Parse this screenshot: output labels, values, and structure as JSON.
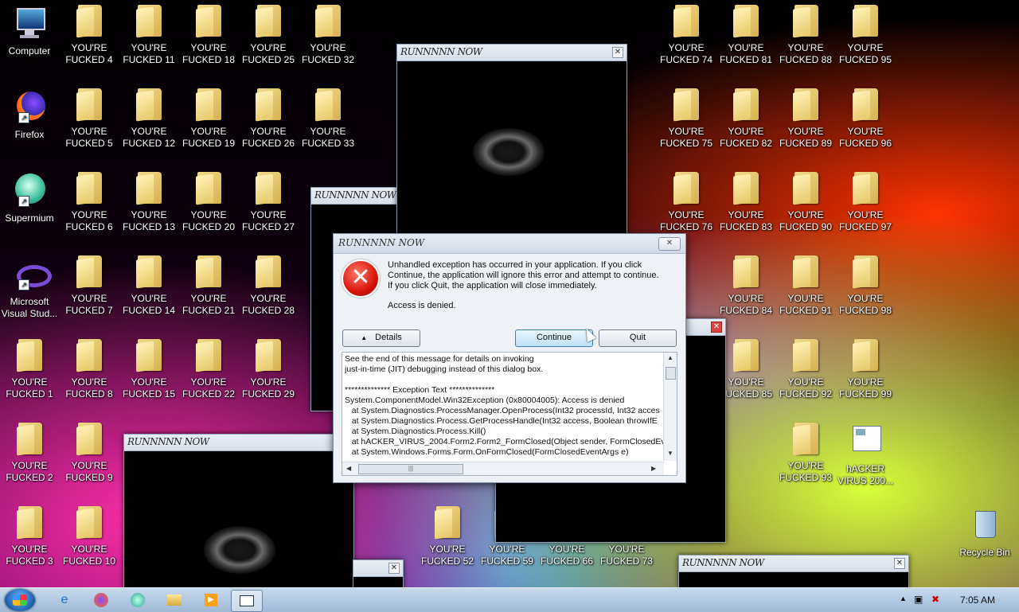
{
  "desktop": {
    "system_icons": [
      {
        "label": "Computer",
        "icon": "computer-icon"
      },
      {
        "label": "Firefox",
        "icon": "firefox-icon"
      },
      {
        "label": "Supermium",
        "icon": "supermium-icon"
      },
      {
        "label": "Microsoft Visual Stud...",
        "icon": "visual-studio-icon"
      }
    ],
    "folders_col0": [
      "YOU'RE FUCKED 1",
      "YOU'RE FUCKED 2",
      "YOU'RE FUCKED 3"
    ],
    "folders_col1": [
      "YOU'RE FUCKED 4",
      "YOU'RE FUCKED 5",
      "YOU'RE FUCKED 6",
      "YOU'RE FUCKED 7",
      "YOU'RE FUCKED 8",
      "YOU'RE FUCKED 9",
      "YOU'RE FUCKED 10"
    ],
    "folders_col2": [
      "YOU'RE FUCKED 11",
      "YOU'RE FUCKED 12",
      "YOU'RE FUCKED 13",
      "YOU'RE FUCKED 14",
      "YOU'RE FUCKED 15"
    ],
    "folders_col3": [
      "YOU'RE FUCKED 18",
      "YOU'RE FUCKED 19",
      "YOU'RE FUCKED 20",
      "YOU'RE FUCKED 21",
      "YOU'RE FUCKED 22"
    ],
    "folders_col4": [
      "YOU'RE FUCKED 25",
      "YOU'RE FUCKED 26",
      "YOU'RE FUCKED 27",
      "YOU'RE FUCKED 28",
      "YOU'RE FUCKED 29"
    ],
    "folders_col5": [
      "YOU'RE FUCKED 32",
      "YOU'RE FUCKED 33"
    ],
    "folders_col11": [
      "YOU'RE FUCKED 74",
      "YOU'RE FUCKED 75",
      "YOU'RE FUCKED 76"
    ],
    "folders_col12": [
      "YOU'RE FUCKED 81",
      "YOU'RE FUCKED 82",
      "YOU'RE FUCKED 83",
      "YOU'RE FUCKED 84",
      "YOU'RE FUCKED 85"
    ],
    "folders_col13": [
      "YOU'RE FUCKED 88",
      "YOU'RE FUCKED 89",
      "YOU'RE FUCKED 90",
      "YOU'RE FUCKED 91",
      "YOU'RE FUCKED 92",
      "YOU'RE FUCKED 93"
    ],
    "folders_col14": [
      "YOU'RE FUCKED 95",
      "YOU'RE FUCKED 96",
      "YOU'RE FUCKED 97",
      "YOU'RE FUCKED 98",
      "YOU'RE FUCKED 99"
    ],
    "bottom_row": [
      "YOU'RE FUCKED 52",
      "YOU'RE FUCKED 59",
      "YOU'RE FUCKED 66",
      "YOU'RE FUCKED 73"
    ],
    "hacker_label": "hACKER VIRUS 200...",
    "recycle_label": "Recycle Bin"
  },
  "windows": {
    "title": "RUNNNNN NOW"
  },
  "dialog": {
    "title": "RUNNNNN NOW",
    "message": "Unhandled exception has occurred in your application. If you click Continue, the application will ignore this error and attempt to continue. If you click Quit, the application will close immediately.",
    "sub_message": "Access is denied.",
    "details_label": "Details",
    "continue_label": "Continue",
    "quit_label": "Quit",
    "details_text": "See the end of this message for details on invoking\njust-in-time (JIT) debugging instead of this dialog box.\n\n************** Exception Text **************\nSystem.ComponentModel.Win32Exception (0x80004005): Access is denied\n   at System.Diagnostics.ProcessManager.OpenProcess(Int32 processId, Int32 acces\n   at System.Diagnostics.Process.GetProcessHandle(Int32 access, Boolean throwIfE\n   at System.Diagnostics.Process.Kill()\n   at hACKER_VIRUS_2004.Form2.Form2_FormClosed(Object sender, FormClosedEv\n   at System.Windows.Forms.Form.OnFormClosed(FormClosedEventArgs e)"
  },
  "taskbar": {
    "clock": "7:05 AM"
  }
}
